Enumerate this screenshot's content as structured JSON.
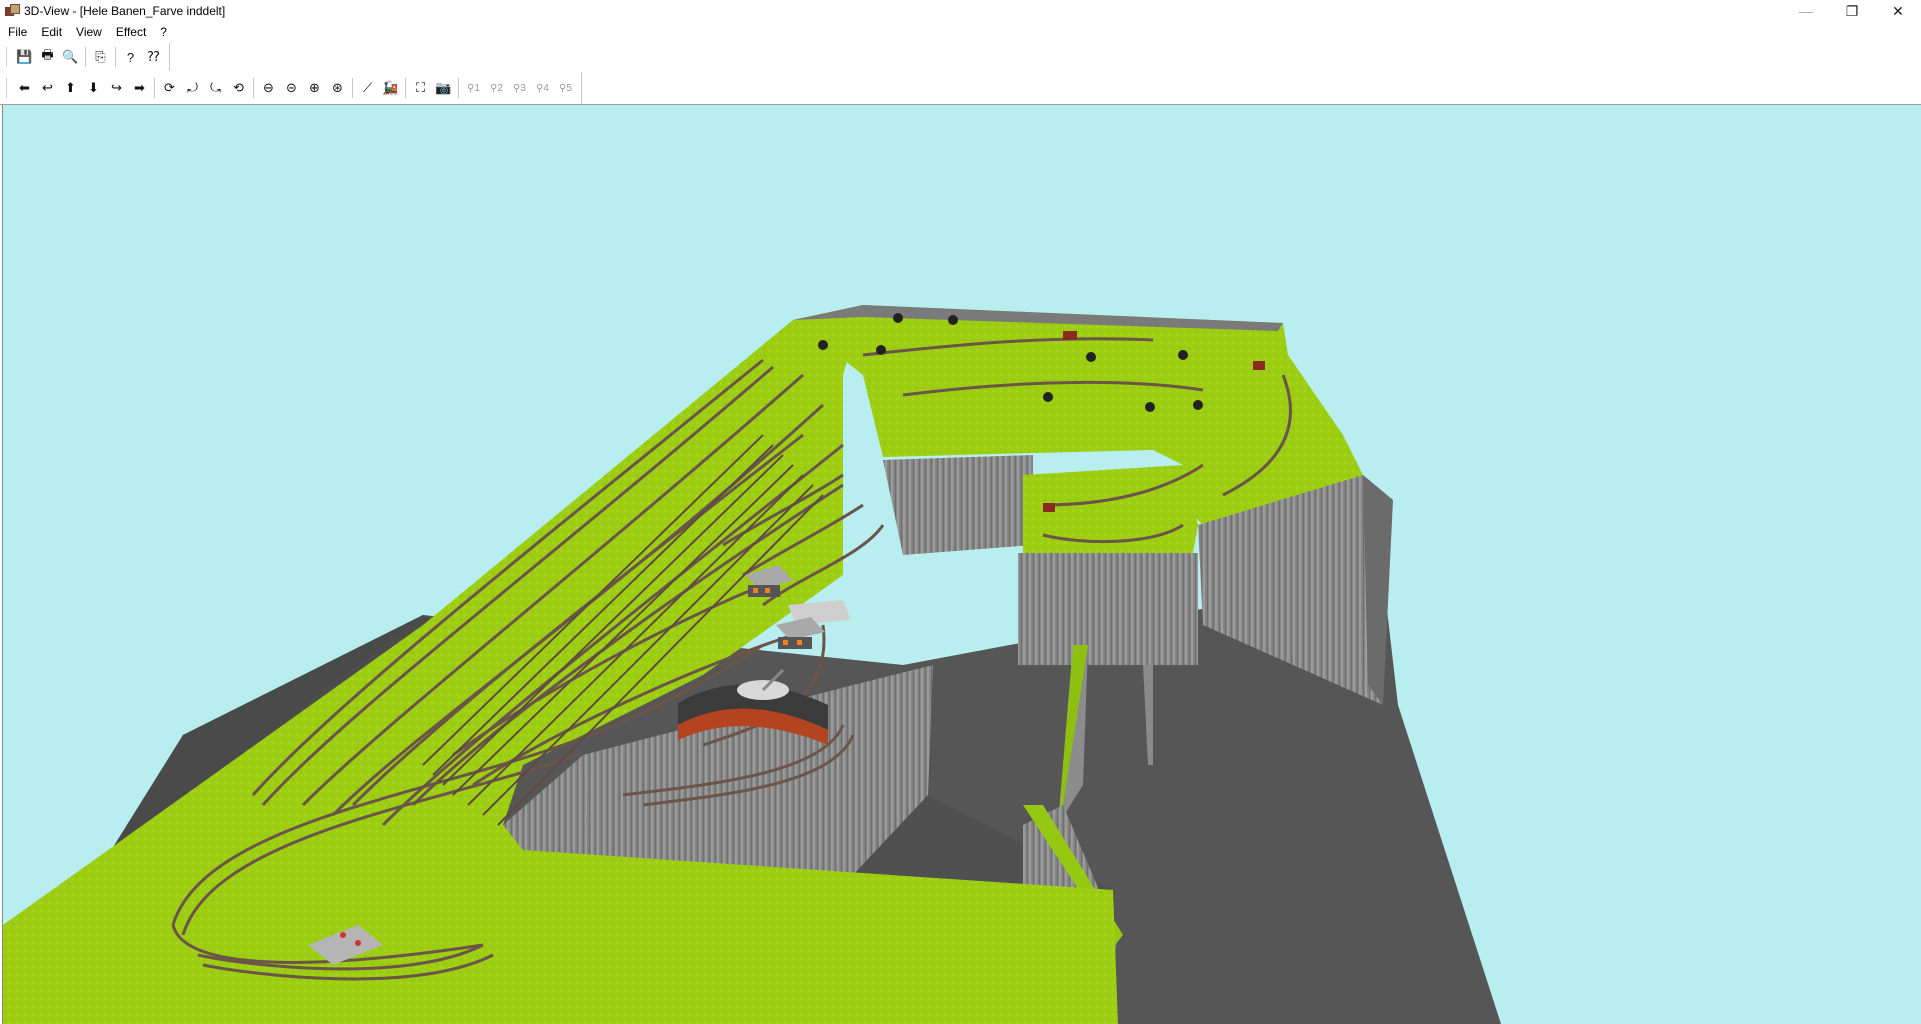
{
  "window": {
    "title": "3D-View - [Hele Banen_Farve inddelt]",
    "controls": {
      "minimize": "—",
      "restore": "❐",
      "close": "✕"
    }
  },
  "menu": [
    "File",
    "Edit",
    "View",
    "Effect",
    "?"
  ],
  "toolbar_top": {
    "groups": [
      [
        {
          "name": "save-icon",
          "glyph": "💾"
        },
        {
          "name": "print-icon",
          "glyph": "🖶"
        },
        {
          "name": "print-preview-icon",
          "glyph": "🔍"
        }
      ],
      [
        {
          "name": "copy-icon",
          "glyph": "⎘"
        }
      ],
      [
        {
          "name": "help-icon",
          "glyph": "?"
        },
        {
          "name": "context-help-icon",
          "glyph": "⁇"
        }
      ]
    ]
  },
  "toolbar_nav": {
    "groups": [
      [
        {
          "name": "move-left-icon",
          "glyph": "⬅"
        },
        {
          "name": "turn-left-icon",
          "glyph": "↩"
        },
        {
          "name": "move-up-icon",
          "glyph": "⬆"
        },
        {
          "name": "move-down-icon",
          "glyph": "⬇"
        },
        {
          "name": "turn-right-icon",
          "glyph": "↪"
        },
        {
          "name": "move-right-icon",
          "glyph": "➡"
        }
      ],
      [
        {
          "name": "view-rotate-1-icon",
          "glyph": "⟳"
        },
        {
          "name": "view-rotate-2-icon",
          "glyph": "⤾"
        },
        {
          "name": "view-rotate-3-icon",
          "glyph": "⤿"
        },
        {
          "name": "view-rotate-4-icon",
          "glyph": "⟲"
        }
      ],
      [
        {
          "name": "zoom-out-icon",
          "glyph": "⊖"
        },
        {
          "name": "zoom-out-small-icon",
          "glyph": "⊝"
        },
        {
          "name": "zoom-in-icon",
          "glyph": "⊕"
        },
        {
          "name": "zoom-fit-icon",
          "glyph": "⊛"
        }
      ],
      [
        {
          "name": "track-icon",
          "glyph": "⟋"
        },
        {
          "name": "train-icon",
          "glyph": "🚂"
        }
      ],
      [
        {
          "name": "fullscreen-icon",
          "glyph": "⛶"
        },
        {
          "name": "camera-icon",
          "glyph": "📷"
        }
      ]
    ],
    "disabled": [
      {
        "name": "viewpoint-1-icon",
        "label": "1"
      },
      {
        "name": "viewpoint-2-icon",
        "label": "2"
      },
      {
        "name": "viewpoint-3-icon",
        "label": "3"
      },
      {
        "name": "viewpoint-4-icon",
        "label": "4"
      },
      {
        "name": "viewpoint-5-icon",
        "label": "5"
      }
    ]
  },
  "colors": {
    "sky": "#b9eef1",
    "grass": "#9acd14",
    "grass_dark": "#7fae0f",
    "cliff": "#8a8a8a",
    "cliff_dark": "#6f6f6f",
    "floor": "#585858",
    "floor_dark": "#4a4a4a",
    "track": "#6b5548",
    "roundhouse": "#b04020",
    "roundhouse_roof": "#3b3b3b"
  }
}
